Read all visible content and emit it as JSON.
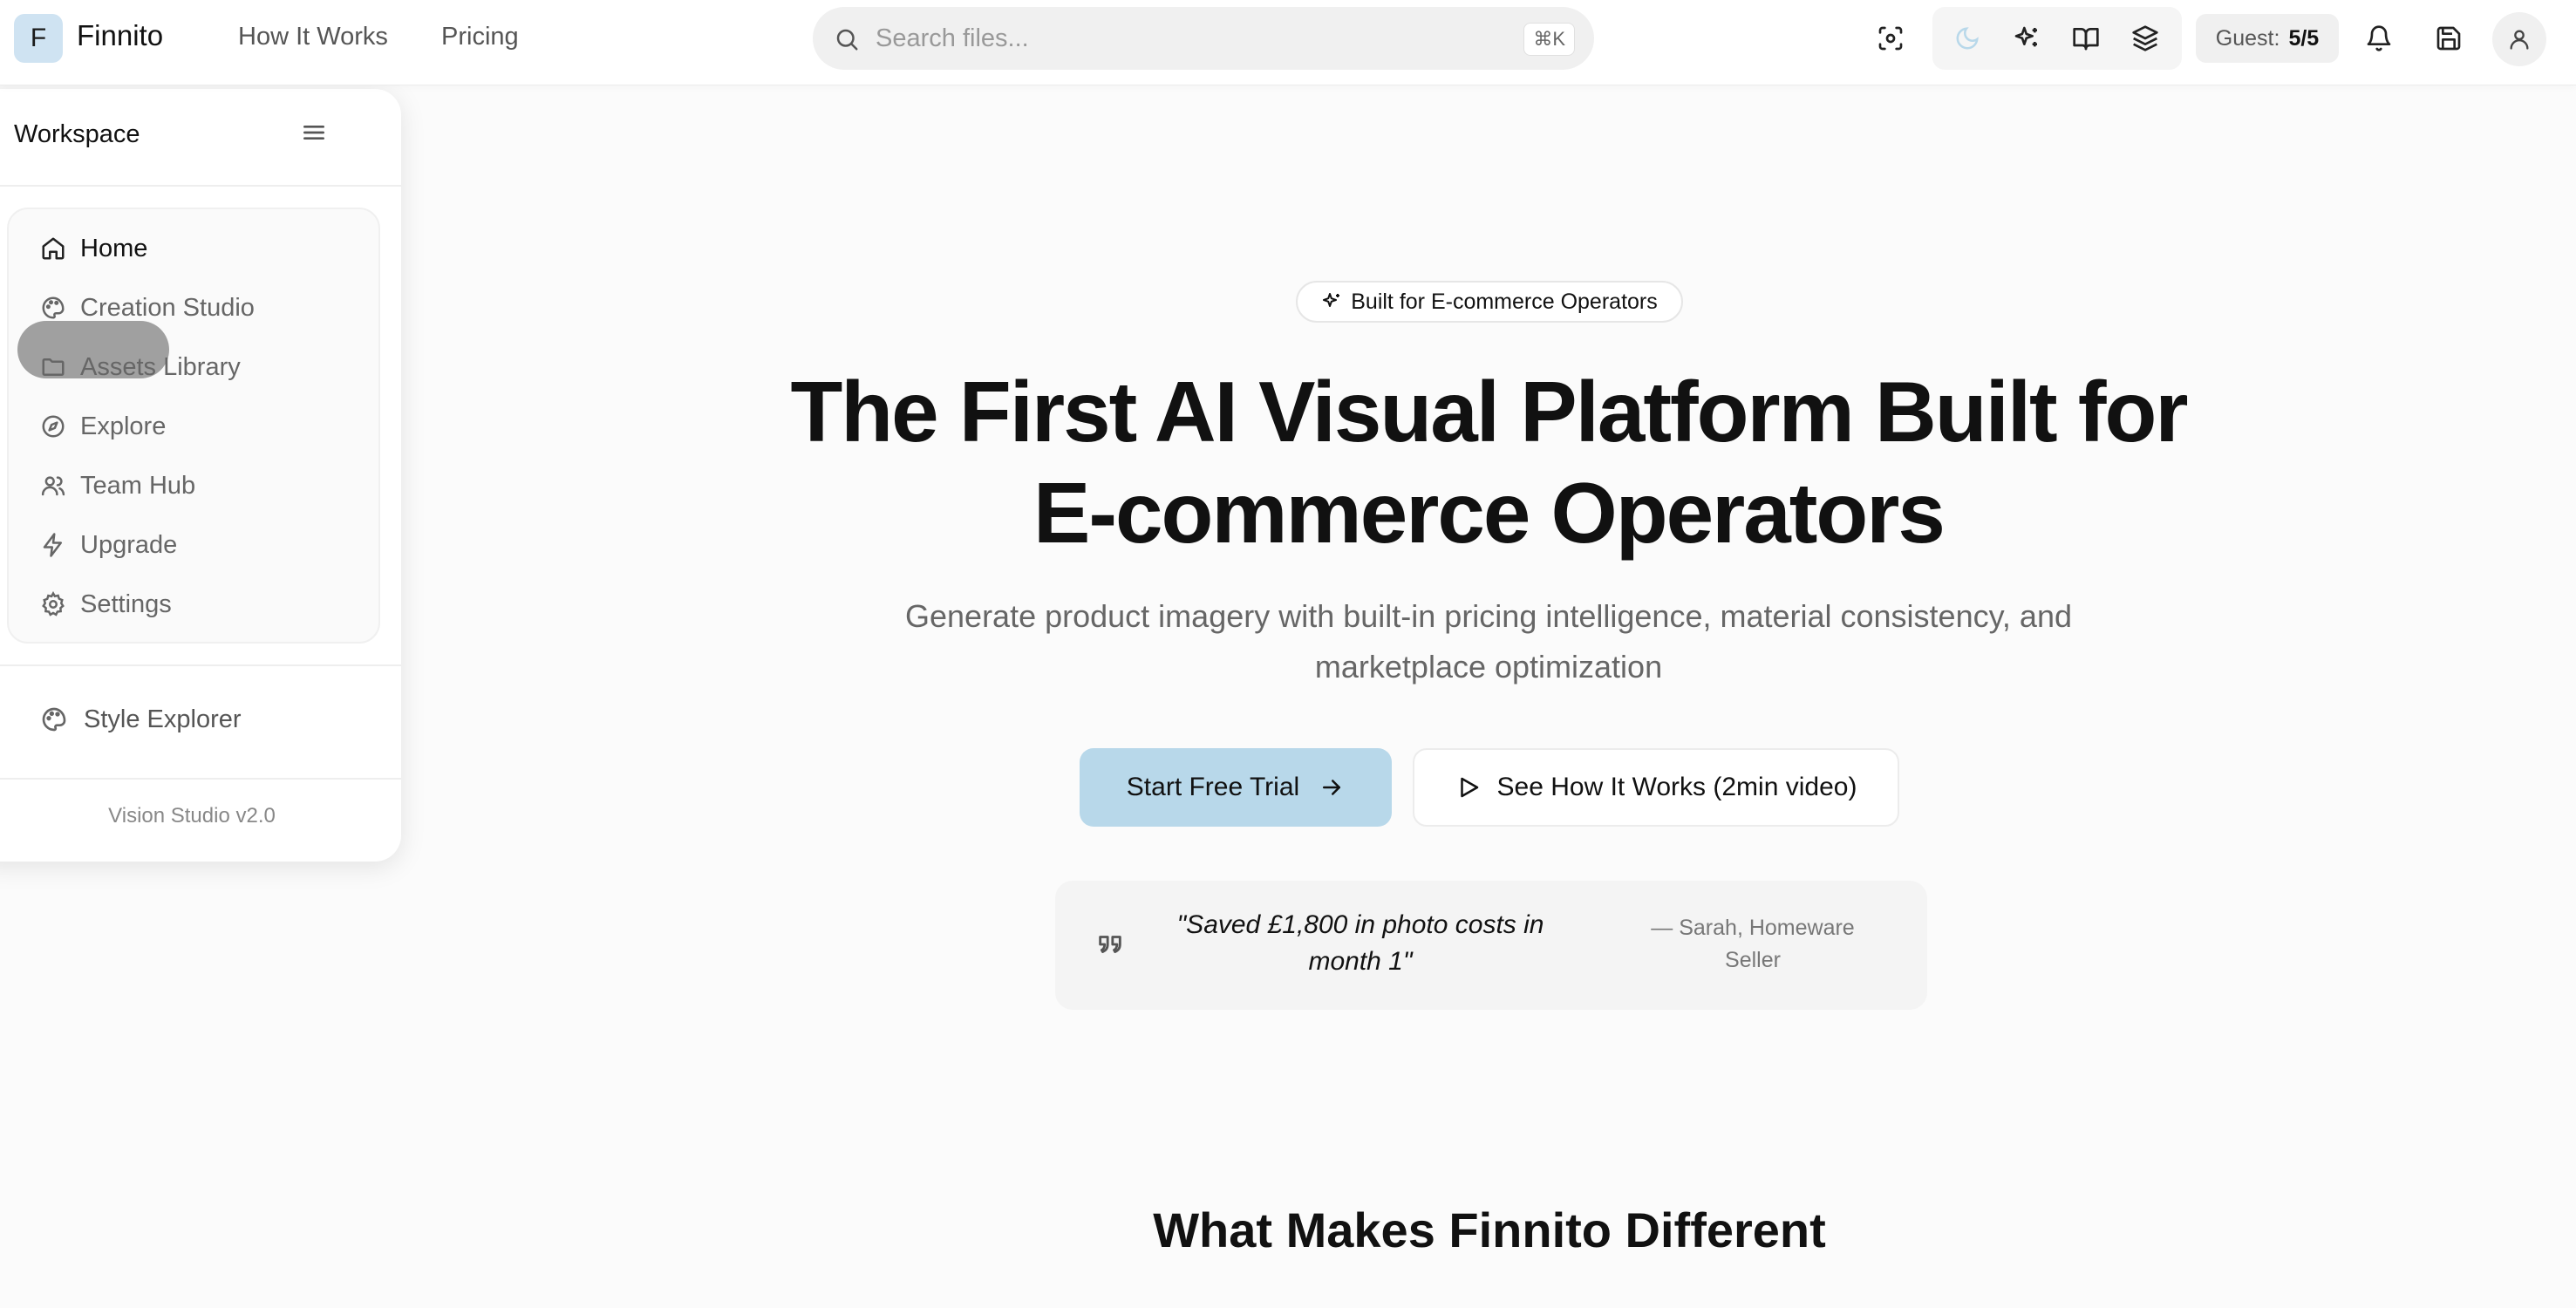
{
  "topbar": {
    "logo_letter": "F",
    "brand": "Finnito",
    "nav": {
      "how_it_works": "How It Works",
      "pricing": "Pricing"
    },
    "search": {
      "placeholder": "Search files...",
      "shortcut": "⌘K"
    },
    "icons": [
      "scan-icon",
      "moon-icon",
      "sparkles-icon",
      "book-open-icon",
      "layers-icon",
      "bell-icon",
      "save-icon",
      "user-icon"
    ],
    "guest": {
      "label": "Guest:",
      "count": "5/5"
    }
  },
  "sidebar": {
    "title": "Workspace",
    "items": [
      {
        "label": "Home",
        "icon": "home-icon",
        "active": true
      },
      {
        "label": "Creation Studio",
        "icon": "palette-icon"
      },
      {
        "label": "Assets Library",
        "icon": "folder-icon"
      },
      {
        "label": "Explore",
        "icon": "compass-icon"
      },
      {
        "label": "Team Hub",
        "icon": "users-icon"
      },
      {
        "label": "Upgrade",
        "icon": "zap-icon"
      },
      {
        "label": "Settings",
        "icon": "gear-icon"
      }
    ],
    "style_explorer": "Style Explorer",
    "version": "Vision Studio v2.0"
  },
  "hero": {
    "badge": "Built for E-commerce Operators",
    "title_line1": "The First AI Visual Platform Built for",
    "title_line2": "E-commerce Operators",
    "subtitle": "Generate product imagery with built-in pricing intelligence, material consistency, and marketplace optimization",
    "cta_primary": "Start Free Trial",
    "cta_secondary": "See How It Works (2min video)",
    "quote": "\"Saved £1,800 in photo costs in month 1\"",
    "quote_author": "— Sarah, Homeware Seller"
  },
  "section": {
    "title": "What Makes Finnito Different"
  },
  "colors": {
    "accent": "#b8d8ea",
    "logo_bg": "#cfe3f2",
    "text": "#111111",
    "muted": "#666666"
  }
}
